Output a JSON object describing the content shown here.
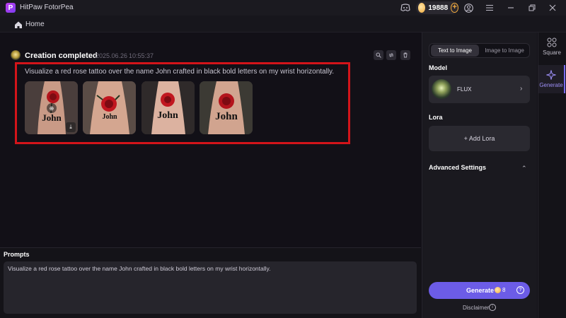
{
  "window": {
    "title": "HitPaw FotorPea",
    "coins": "19888",
    "controls": [
      "discord-icon",
      "user-circle-icon",
      "menu-icon",
      "minimize-icon",
      "restore-icon",
      "close-icon"
    ]
  },
  "breadcrumb": {
    "home_label": "Home"
  },
  "creation": {
    "status_title": "Creation completed",
    "date": "2025.06.26",
    "time": "10:55:37",
    "prompt": "Visualize a red rose tattoo over the name John crafted in black bold letters on my wrist horizontally.",
    "images": [
      {
        "label": "John"
      },
      {
        "label": "John"
      },
      {
        "label": "John"
      },
      {
        "label": "John"
      }
    ]
  },
  "prompts": {
    "label": "Prompts",
    "value": "Visualize a red rose tattoo over the name John crafted in black bold letters on my wrist horizontally."
  },
  "settings": {
    "tabs": [
      {
        "label": "Text to Image",
        "active": true
      },
      {
        "label": "Image to Image",
        "active": false
      }
    ],
    "model_label": "Model",
    "model_name": "FLUX",
    "lora_label": "Lora",
    "add_lora": "+ Add Lora",
    "advanced_label": "Advanced Settings",
    "generate_label": "Generate",
    "generate_cost": "8",
    "disclaimer": "Disclaimer"
  },
  "rail": {
    "items": [
      {
        "label": "Square",
        "icon": "grid-icon",
        "active": false
      },
      {
        "label": "Generate",
        "icon": "sparkle-icon",
        "active": true
      }
    ]
  },
  "colors": {
    "accent": "#6c5ce7",
    "highlight": "#d3141a",
    "coin": "#f0a93c",
    "background": "#121017"
  }
}
